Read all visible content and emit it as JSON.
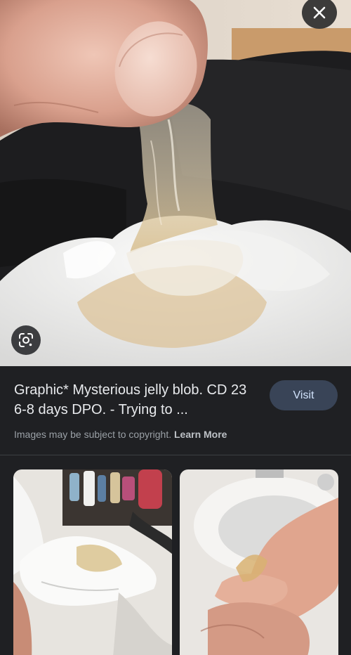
{
  "result": {
    "title": "Graphic* Mysterious jelly blob. CD 23 6-8 days DPO. - Trying to ...",
    "visit_label": "Visit",
    "copyright_text": "Images may be subject to copyright.",
    "learn_more_label": "Learn More"
  },
  "icons": {
    "close": "close-icon",
    "lens": "google-lens-icon"
  },
  "colors": {
    "background": "#1f2023",
    "visit_button": "#394457",
    "visit_text": "#d2e3fc",
    "title_text": "#e8eaed",
    "muted_text": "#9aa0a6"
  }
}
